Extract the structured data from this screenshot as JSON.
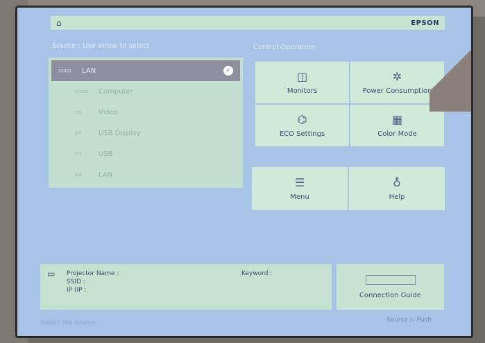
{
  "topbar": {
    "home_icon": "⌂",
    "brand": "EPSON"
  },
  "sources": {
    "title": "Source : Use arrow to select",
    "items": [
      {
        "num": "",
        "glyph": "▭▭",
        "label": "LAN",
        "selected": true,
        "check": "✓"
      },
      {
        "num": "",
        "glyph": "▭▭",
        "label": "Computer"
      },
      {
        "num": "",
        "glyph": "▭",
        "label": "Video"
      },
      {
        "num": "",
        "glyph": "▭",
        "label": "USB Display"
      },
      {
        "num": "",
        "glyph": "▭",
        "label": "USB"
      },
      {
        "num": "",
        "glyph": "▭",
        "label": "LAN"
      }
    ]
  },
  "functions": {
    "title": "Control Operation",
    "tiles": [
      {
        "icon": "◫",
        "label": "Monitors"
      },
      {
        "icon": "✲",
        "label": "Power Consumption"
      },
      {
        "icon": "⌬",
        "label": "ECO Settings"
      },
      {
        "icon": "▦",
        "label": "Color Mode"
      }
    ],
    "tiles2": [
      {
        "icon": "☰",
        "label": "Menu"
      },
      {
        "icon": "♁",
        "label": "Help"
      }
    ]
  },
  "info": {
    "icon": "▭",
    "projector_name_label": "Projector Name :",
    "ssid_label": "SSID :",
    "ip_label": "IP (IP :",
    "keyword_label": "Keyword :"
  },
  "connect": {
    "label": "Connection Guide"
  },
  "footer": {
    "left": "Select the source",
    "right": "Source ▷ Push"
  }
}
